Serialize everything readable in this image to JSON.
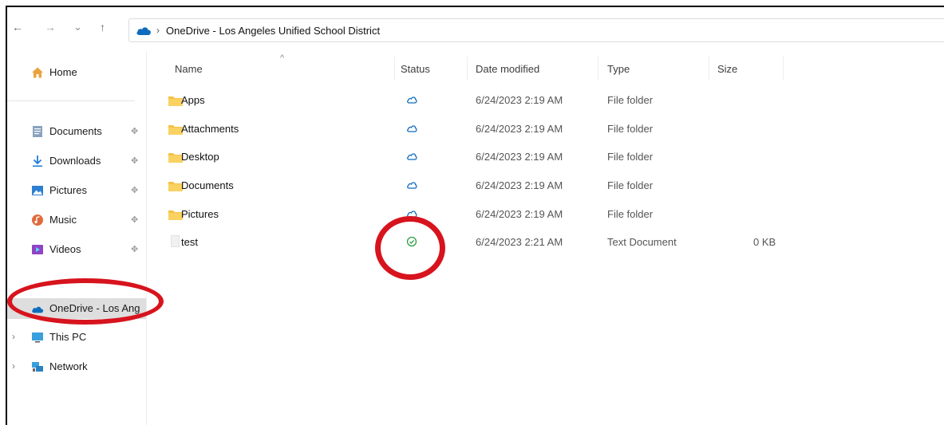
{
  "nav": {
    "back_icon": "←",
    "forward_icon": "→",
    "recent_icon": "⌄",
    "up_icon": "↑"
  },
  "address": {
    "separator": "›",
    "path": "OneDrive - Los Angeles Unified School District"
  },
  "sidebar": {
    "home": "Home",
    "quick_access": [
      {
        "label": "Documents",
        "icon": "documents-icon"
      },
      {
        "label": "Downloads",
        "icon": "downloads-icon"
      },
      {
        "label": "Pictures",
        "icon": "pictures-icon"
      },
      {
        "label": "Music",
        "icon": "music-icon"
      },
      {
        "label": "Videos",
        "icon": "videos-icon"
      }
    ],
    "onedrive": "OneDrive - Los Ang",
    "this_pc": "This PC",
    "network": "Network",
    "chevron": "›"
  },
  "columns": {
    "name": "Name",
    "status": "Status",
    "date": "Date modified",
    "type": "Type",
    "size": "Size",
    "sort_indicator": "^"
  },
  "files": [
    {
      "name": "Apps",
      "status": "cloud",
      "date": "6/24/2023 2:19 AM",
      "type": "File folder",
      "size": ""
    },
    {
      "name": "Attachments",
      "status": "cloud",
      "date": "6/24/2023 2:19 AM",
      "type": "File folder",
      "size": ""
    },
    {
      "name": "Desktop",
      "status": "cloud",
      "date": "6/24/2023 2:19 AM",
      "type": "File folder",
      "size": ""
    },
    {
      "name": "Documents",
      "status": "cloud",
      "date": "6/24/2023 2:19 AM",
      "type": "File folder",
      "size": ""
    },
    {
      "name": "Pictures",
      "status": "cloud",
      "date": "6/24/2023 2:19 AM",
      "type": "File folder",
      "size": ""
    },
    {
      "name": "test",
      "status": "synced",
      "date": "6/24/2023 2:21 AM",
      "type": "Text Document",
      "size": "0 KB"
    }
  ],
  "colors": {
    "annotation": "#d7141e",
    "onedrive_blue": "#0f6cbd",
    "folder_yellow": "#f6c244",
    "synced_green": "#2e9e44"
  }
}
